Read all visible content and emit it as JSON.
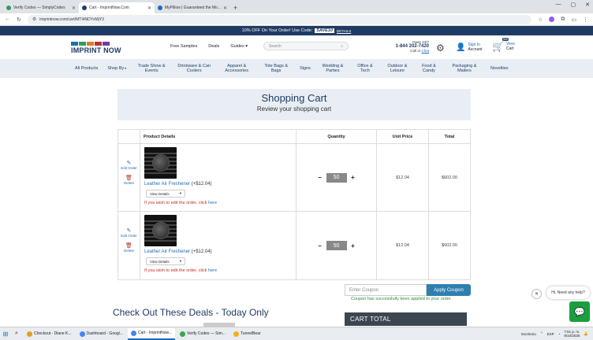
{
  "browser": {
    "tabs": [
      {
        "label": "Verify Codes — SimplyCodes",
        "color": "#2e9e5b",
        "active": false
      },
      {
        "label": "Cart - ImprintNow.Com",
        "color": "#1f3b63",
        "active": true
      },
      {
        "label": "MyPillow | Guaranteed the Mo...",
        "color": "#1e6bb8",
        "active": false
      }
    ],
    "new_tab": "+",
    "url": "imprintnow.com/cart/MTI4NDYxMjY3"
  },
  "promo": {
    "text": "10% OFF On Your Order! Use Code:",
    "code": "SAVE10",
    "details": "DETAILS"
  },
  "header": {
    "logo": "IMPRINT NOW",
    "logo_colors": [
      "#1e6bb8",
      "#2e9e5b",
      "#e07b1f",
      "#c0302a",
      "#6b3fa0"
    ],
    "nav": [
      "Free Samples",
      "Deals",
      "Guides"
    ],
    "search_placeholder": "Search",
    "phone_hours": "Open 24/7",
    "phone": "1-844 202-7420",
    "call_or": "Call or",
    "chat": "Chat",
    "sign_in": "Sign In",
    "account": "Account",
    "cart_badge": "$55",
    "view": "View",
    "cart": "Cart"
  },
  "categories": [
    {
      "label": "All Products"
    },
    {
      "label": "Shop By",
      "chev": true
    },
    {
      "label": "Trade Show & Events",
      "chev": true
    },
    {
      "label": "Drinkware & Can Coolers",
      "chev": true
    },
    {
      "label": "Apparel & Accessories",
      "chev": true
    },
    {
      "label": "Tote Bags & Bags",
      "chev": true
    },
    {
      "label": "Signs",
      "chev": true
    },
    {
      "label": "Wedding & Parties",
      "chev": true
    },
    {
      "label": "Office & Tech",
      "chev": true
    },
    {
      "label": "Outdoor & Leisure",
      "chev": true
    },
    {
      "label": "Food & Candy",
      "chev": true
    },
    {
      "label": "Packaging & Mailers",
      "chev": true
    },
    {
      "label": "Novelties",
      "chev": true
    }
  ],
  "cart_page": {
    "title": "Shopping Cart",
    "subtitle": "Review your shopping cart",
    "columns": [
      "Product Details",
      "Quantity",
      "Unit Price",
      "Total"
    ],
    "edit_label": "Edit Order",
    "delete_label": "Delete",
    "items": [
      {
        "name": "Leather Air Freshener",
        "extra": "(+$12.04)",
        "view_details": "View Details",
        "edit_note": "If you wish to edit the order, click",
        "here": "here",
        "qty": "50",
        "unit_price": "$12.04",
        "total": "$602.00"
      },
      {
        "name": "Leather Air Freshener",
        "extra": "(+$12.04)",
        "view_details": "View Details",
        "edit_note": "If you wish to edit the order, click",
        "here": "here",
        "qty": "50",
        "unit_price": "$12.04",
        "total": "$602.00"
      }
    ],
    "coupon_placeholder": "Enter Coupon",
    "apply_coupon": "Apply Coupon",
    "coupon_msg": "Coupon has successfully been applied to your order.",
    "deals_heading": "Check Out These Deals - Today Only",
    "cart_total": "CART TOTAL"
  },
  "chat_widget": {
    "close": "✕",
    "bubble": "Hi. Need any help?"
  },
  "taskbar": {
    "apps": [
      {
        "label": "Checkout - Diane K...",
        "color": "#e0a020",
        "active": false
      },
      {
        "label": "Dashboard - Googl...",
        "color": "#4285f4",
        "active": false
      },
      {
        "label": "Cart - ImprintNow...",
        "color": "#4285f4",
        "active": true
      },
      {
        "label": "Verify Codes — Sim...",
        "color": "#34a853",
        "active": false
      },
      {
        "label": "TunnelBear",
        "color": "#f2b01e",
        "active": false
      }
    ],
    "tray_label": "Escritorio",
    "lang": "ESP",
    "time": "7:51 p. m.",
    "date": "8/10/2025"
  }
}
